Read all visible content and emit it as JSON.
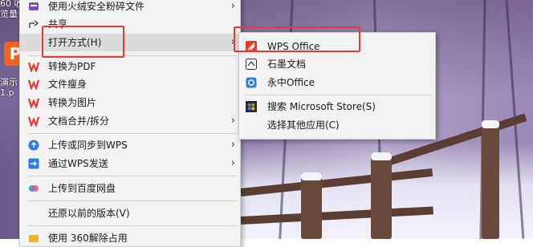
{
  "desktop": {
    "icon_label_top": "60 收\n览量",
    "icon_label_bottom": "演示\n1.p"
  },
  "context_menu": {
    "items": [
      {
        "label": "使用火绒安全粉碎文件"
      },
      {
        "label": "共享"
      },
      {
        "label": "打开方式(H)"
      },
      {
        "label": "转换为PDF"
      },
      {
        "label": "文件瘦身"
      },
      {
        "label": "转换为图片"
      },
      {
        "label": "文档合并/拆分"
      },
      {
        "label": "上传或同步到WPS"
      },
      {
        "label": "通过WPS发送"
      },
      {
        "label": "上传到百度网盘"
      },
      {
        "label": "还原以前的版本(V)"
      },
      {
        "label": "使用 360解除占用"
      }
    ]
  },
  "open_with_menu": {
    "items": [
      {
        "label": "WPS Office"
      },
      {
        "label": "石墨文档"
      },
      {
        "label": "永中Office"
      },
      {
        "label": "搜索 Microsoft Store(S)"
      },
      {
        "label": "选择其他应用(C)"
      }
    ]
  },
  "colors": {
    "highlight_box": "#e53b3b",
    "wps_red": "#e8392b",
    "menu_bg": "#f2f2f2"
  }
}
